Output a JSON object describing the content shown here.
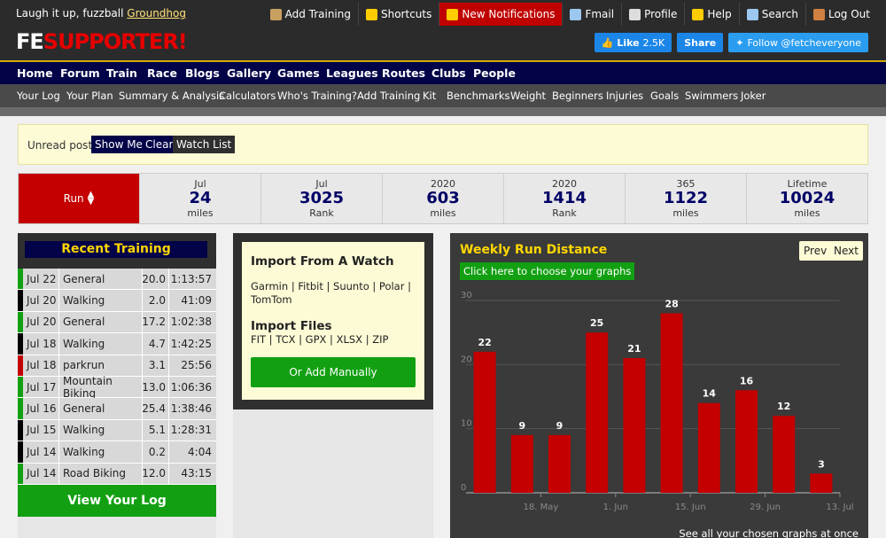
{
  "header": {
    "greeting_prefix": "Laugh it up, fuzzball",
    "greeting_user": "Groundhog",
    "links": [
      {
        "label": "Add Training",
        "icon": "clipboard-icon",
        "color": "#c8a060"
      },
      {
        "label": "Shortcuts",
        "icon": "lightning-icon",
        "color": "#ffcc00"
      },
      {
        "label": "New Notifications",
        "icon": "bell-icon",
        "color": "#ffcc00"
      },
      {
        "label": "Fmail",
        "icon": "mail-icon",
        "color": "#9cc8f0"
      },
      {
        "label": "Profile",
        "icon": "gear-icon",
        "color": "#dddddd"
      },
      {
        "label": "Help",
        "icon": "lightbulb-icon",
        "color": "#ffcc00"
      },
      {
        "label": "Search",
        "icon": "search-icon",
        "color": "#9cc8f0"
      },
      {
        "label": "Log Out",
        "icon": "door-icon",
        "color": "#d08040"
      }
    ],
    "logo_fe": "FE",
    "logo_supporter": "SUPPORTER!",
    "social": {
      "like_label": "Like",
      "like_count": "2.5K",
      "share_label": "Share",
      "follow_label": "Follow @fetcheveryone"
    }
  },
  "nav_main": [
    "Home",
    "Forum",
    "Train",
    "Race",
    "Blogs",
    "Gallery",
    "Games",
    "Leagues",
    "Routes",
    "Clubs",
    "People"
  ],
  "nav_sub": [
    "Your Log",
    "Your Plan",
    "Summary & Analysis",
    "Calculators",
    "Who's Training?",
    "Add Training",
    "Kit",
    "Benchmarks",
    "Weight",
    "Beginners",
    "Injuries",
    "Goals",
    "Swimmers",
    "Joker"
  ],
  "unread": {
    "label": "Unread posts",
    "show_me": "Show Me",
    "clear": "Clear",
    "watch_list": "Watch List"
  },
  "stats": {
    "activity": "Run",
    "cells": [
      {
        "period": "Jul",
        "value": "24",
        "unit": "miles"
      },
      {
        "period": "Jul",
        "value": "3025",
        "unit": "Rank"
      },
      {
        "period": "2020",
        "value": "603",
        "unit": "miles"
      },
      {
        "period": "2020",
        "value": "1414",
        "unit": "Rank"
      },
      {
        "period": "365",
        "value": "1122",
        "unit": "miles"
      },
      {
        "period": "Lifetime",
        "value": "10024",
        "unit": "miles"
      }
    ]
  },
  "recent": {
    "title": "Recent Training",
    "rows": [
      {
        "date": "Jul 22",
        "type": "General",
        "miles": "20.0",
        "time": "1:13:57",
        "color": "#12a012"
      },
      {
        "date": "Jul 20",
        "type": "Walking",
        "miles": "2.0",
        "time": "41:09",
        "color": "#000000"
      },
      {
        "date": "Jul 20",
        "type": "General",
        "miles": "17.2",
        "time": "1:02:38",
        "color": "#12a012"
      },
      {
        "date": "Jul 18",
        "type": "Walking",
        "miles": "4.7",
        "time": "1:42:25",
        "color": "#000000"
      },
      {
        "date": "Jul 18",
        "type": "parkrun",
        "miles": "3.1",
        "time": "25:56",
        "color": "#c40000"
      },
      {
        "date": "Jul 17",
        "type": "Mountain Biking",
        "miles": "13.0",
        "time": "1:06:36",
        "color": "#12a012"
      },
      {
        "date": "Jul 16",
        "type": "General",
        "miles": "25.4",
        "time": "1:38:46",
        "color": "#12a012"
      },
      {
        "date": "Jul 15",
        "type": "Walking",
        "miles": "5.1",
        "time": "1:28:31",
        "color": "#000000"
      },
      {
        "date": "Jul 14",
        "type": "Walking",
        "miles": "0.2",
        "time": "4:04",
        "color": "#000000"
      },
      {
        "date": "Jul 14",
        "type": "Road Biking",
        "miles": "12.0",
        "time": "43:15",
        "color": "#12a012"
      }
    ],
    "view_log": "View Your Log"
  },
  "import": {
    "watch_title": "Import From A Watch",
    "watch_list": "Garmin | Fitbit | Suunto | Polar | TomTom",
    "files_title": "Import Files",
    "files_list": "FIT | TCX | GPX | XLSX | ZIP",
    "add_manually": "Or Add Manually"
  },
  "chart_panel": {
    "prev": "Prev",
    "next": "Next",
    "choose": "Click here to choose your graphs",
    "see_all": "See all your chosen graphs at once"
  },
  "chart_data": {
    "type": "bar",
    "title": "Weekly Run Distance",
    "values": [
      22,
      9,
      9,
      25,
      21,
      28,
      14,
      16,
      12,
      3
    ],
    "x_tick_labels": [
      "18. May",
      "1. Jun",
      "15. Jun",
      "29. Jun",
      "13. Jul"
    ],
    "y_ticks": [
      0,
      10,
      20,
      30
    ],
    "ylim": [
      0,
      30
    ],
    "bar_color": "#c40000",
    "grid": true
  }
}
